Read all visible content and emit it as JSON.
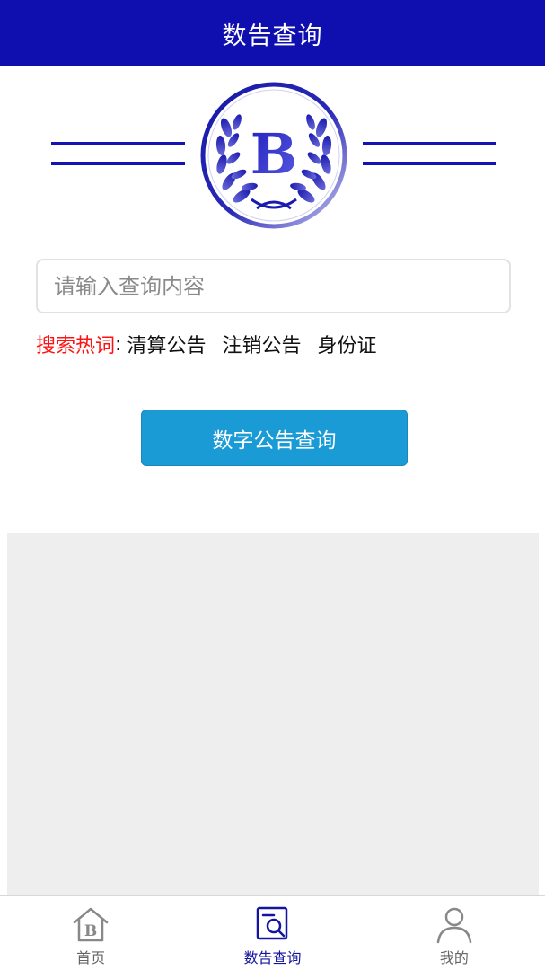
{
  "header": {
    "title": "数告查询"
  },
  "logo": {
    "letter": "B"
  },
  "search": {
    "placeholder": "请输入查询内容",
    "value": ""
  },
  "hotwords": {
    "label": "搜索热词",
    "colon": ":",
    "items": [
      "清算公告",
      "注销公告",
      "身份证"
    ]
  },
  "query_button": {
    "label": "数字公告查询"
  },
  "nav": {
    "items": [
      {
        "label": "首页",
        "icon": "home-icon",
        "icon_letter": "B"
      },
      {
        "label": "数告查询",
        "icon": "search-document-icon"
      },
      {
        "label": "我的",
        "icon": "user-icon"
      }
    ],
    "active_index": 1
  },
  "colors": {
    "header_bg": "#0f0fb0",
    "accent": "#1414b4",
    "button_bg": "#1b9bd6",
    "hot_label": "#ff1111",
    "panel_bg": "#eeeeee"
  }
}
